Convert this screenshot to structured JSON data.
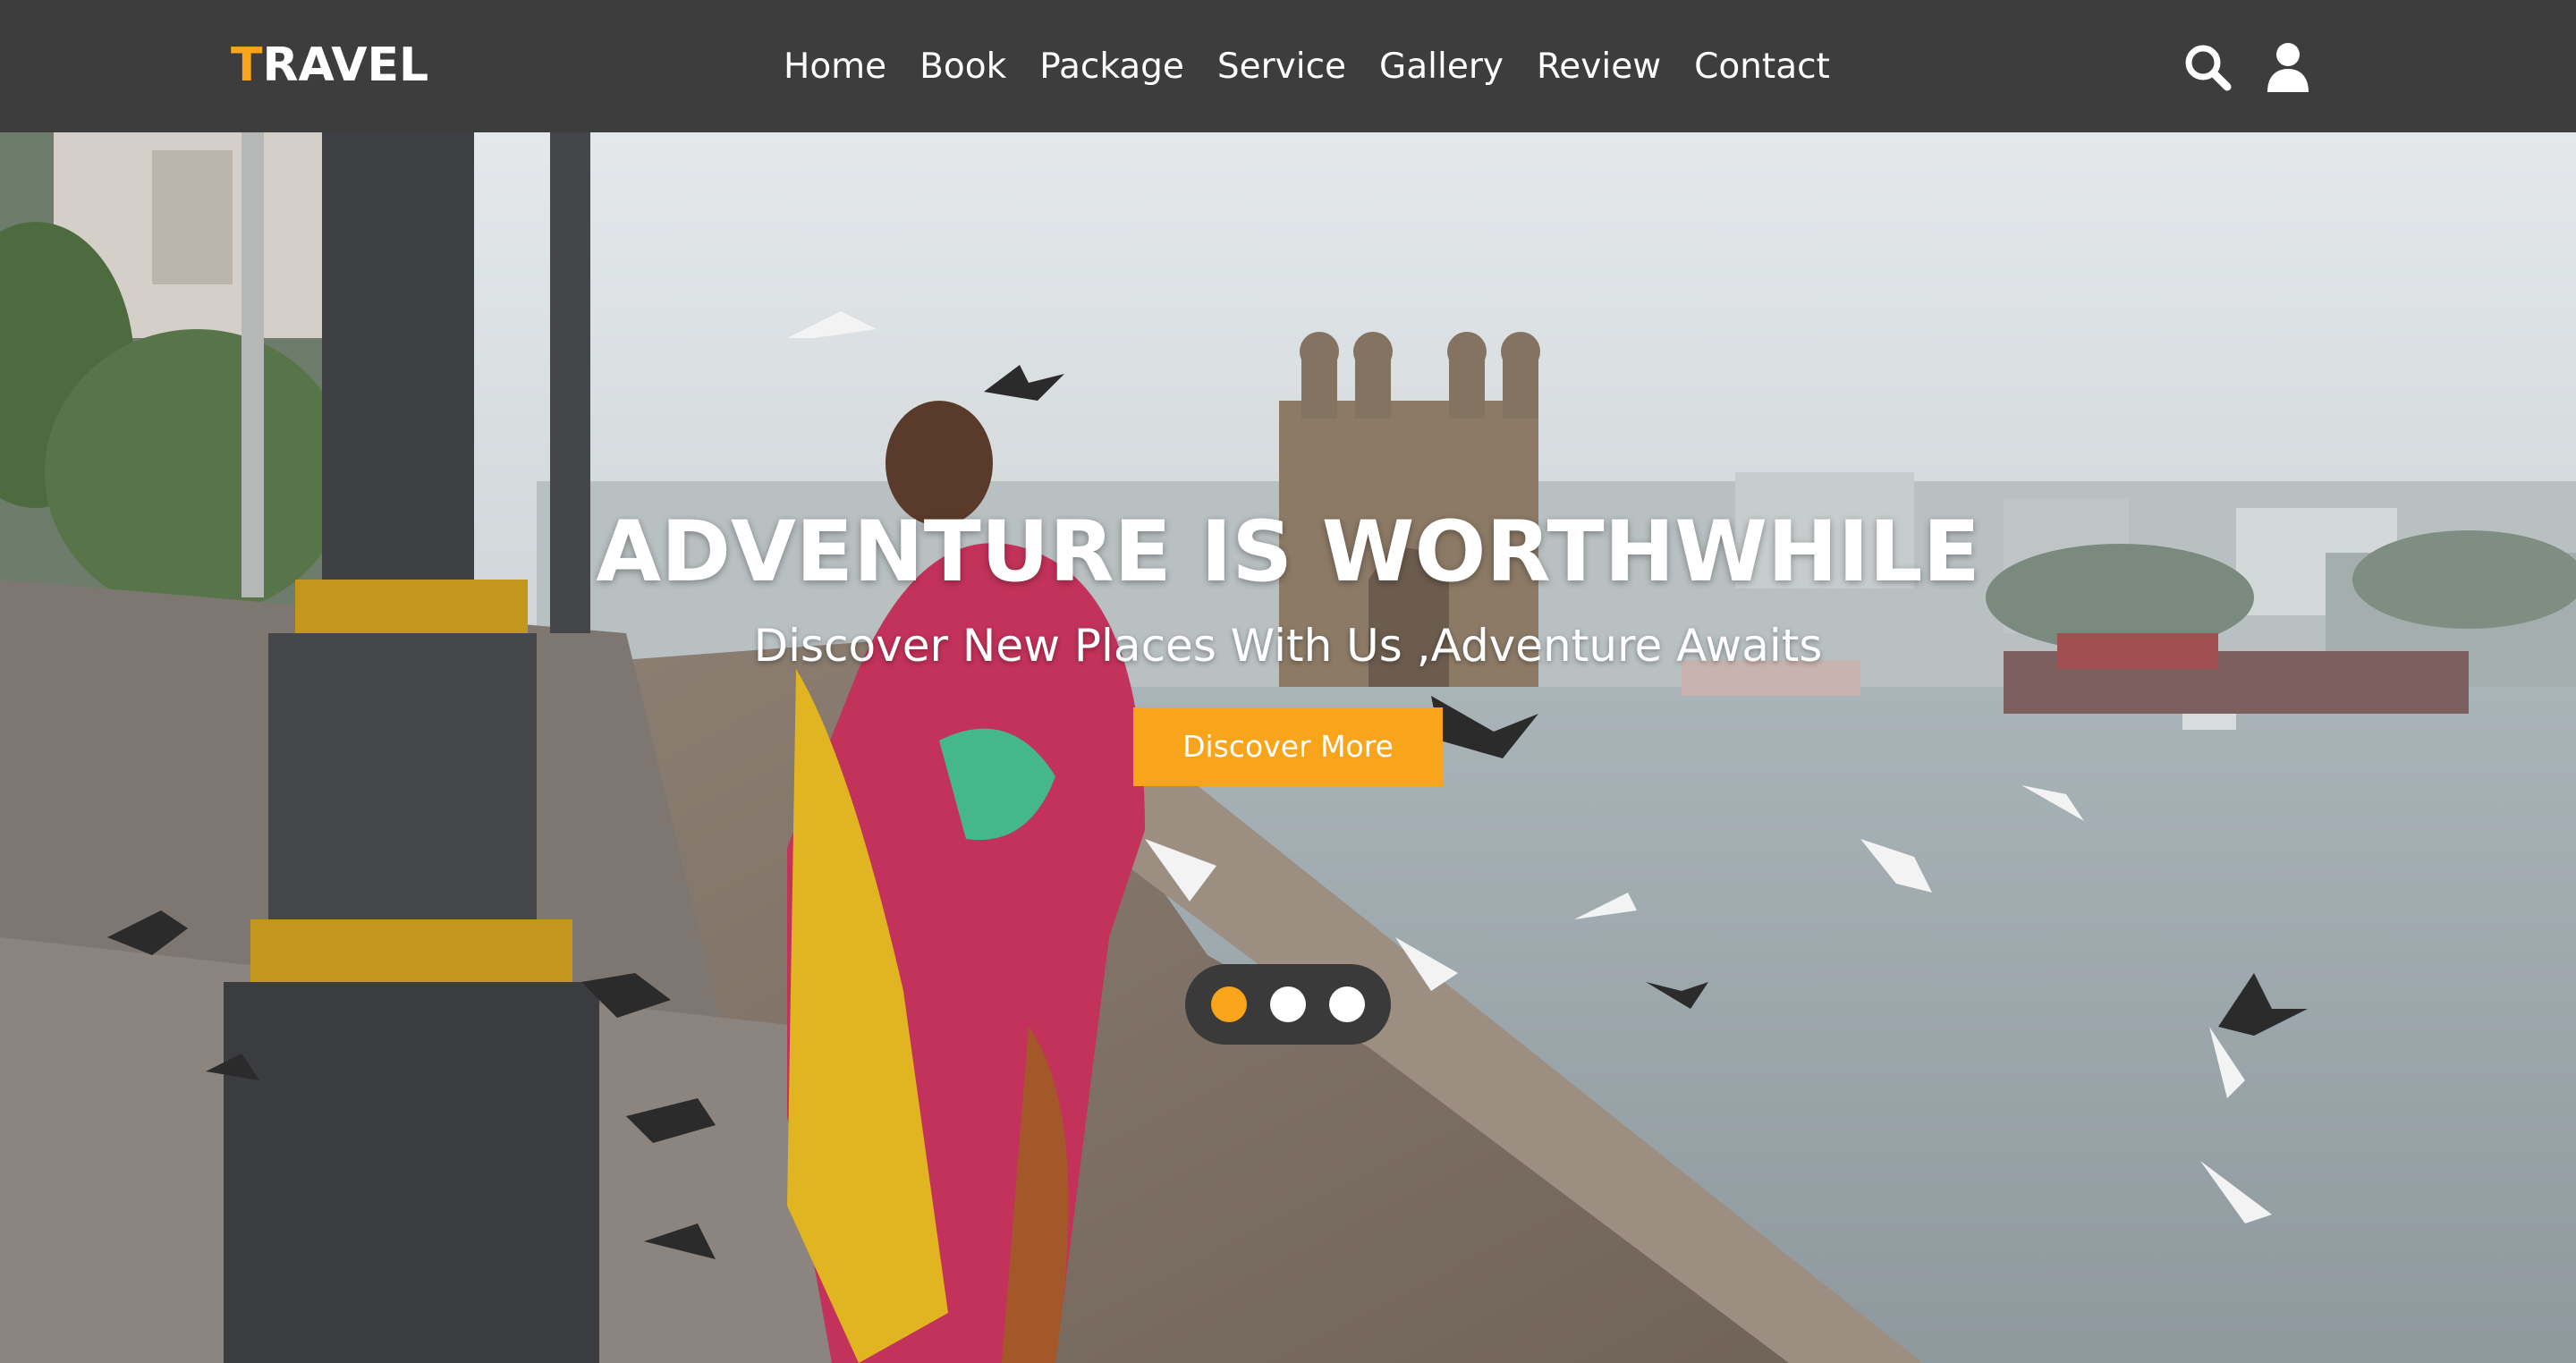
{
  "header": {
    "logo_first_letter": "T",
    "logo_rest": "RAVEL",
    "nav": [
      "Home",
      "Book",
      "Package",
      "Service",
      "Gallery",
      "Review",
      "Contact"
    ],
    "icons": [
      "search-icon",
      "user-icon"
    ]
  },
  "hero": {
    "title": "ADVENTURE IS WORTHWHILE",
    "subtitle": "Discover New Places With Us ,Adventure Awaits",
    "cta_label": "Discover More",
    "slides": {
      "count": 3,
      "active_index": 0
    }
  },
  "colors": {
    "header_bg": "#3d3d3d",
    "accent": "#f9a51c",
    "text": "#ffffff"
  }
}
